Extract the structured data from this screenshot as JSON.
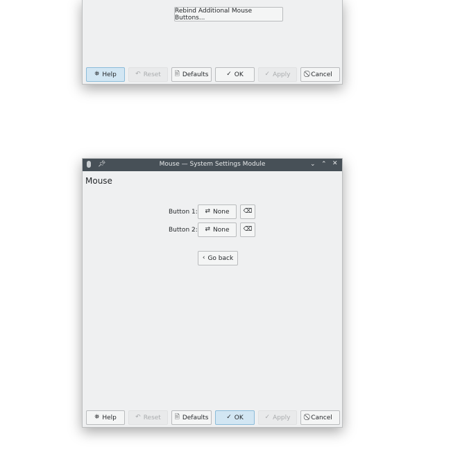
{
  "window1": {
    "rebind_label": "Rebind Additional Mouse Buttons...",
    "buttons": {
      "help": "Help",
      "reset": "Reset",
      "defaults": "Defaults",
      "ok": "OK",
      "apply": "Apply",
      "cancel": "Cancel"
    }
  },
  "window2": {
    "title": "Mouse — System Settings Module",
    "heading": "Mouse",
    "rows": [
      {
        "label": "Button 1:",
        "value": "None"
      },
      {
        "label": "Button 2:",
        "value": "None"
      }
    ],
    "go_back": "Go back",
    "buttons": {
      "help": "Help",
      "reset": "Reset",
      "defaults": "Defaults",
      "ok": "OK",
      "apply": "Apply",
      "cancel": "Cancel"
    }
  },
  "colors": {
    "titlebar": "#475057",
    "focus": "#d2e6f3",
    "window_bg": "#eff0f1"
  }
}
